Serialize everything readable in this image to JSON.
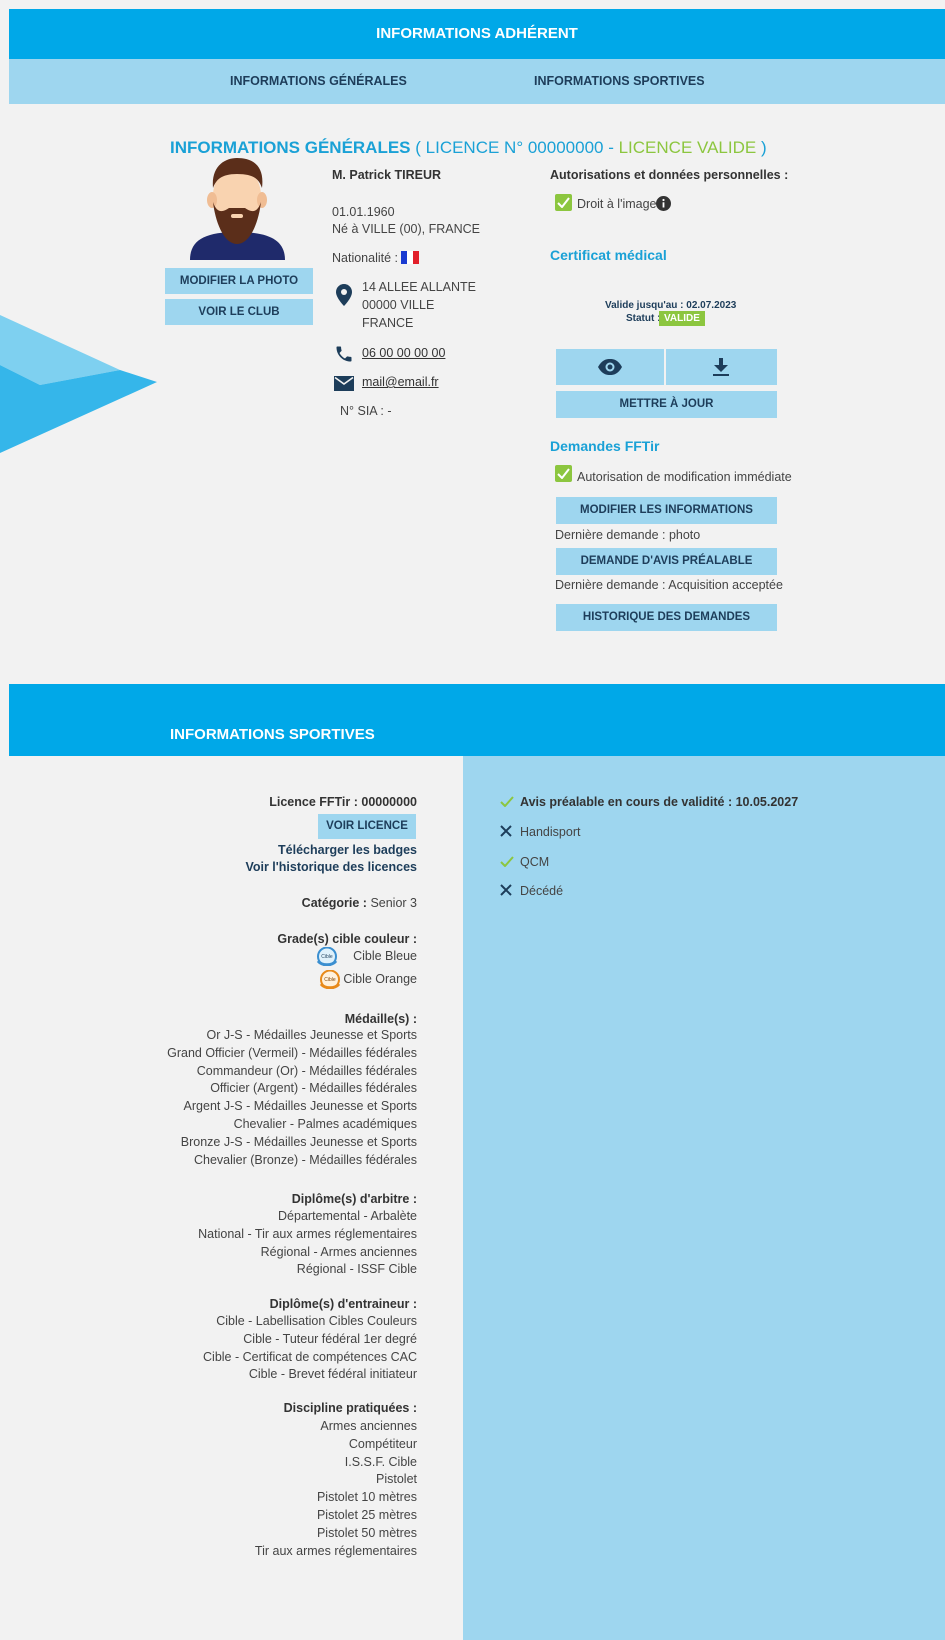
{
  "header": {
    "title": "INFORMATIONS ADHÉRENT"
  },
  "tabs": [
    {
      "label": "INFORMATIONS GÉNÉRALES"
    },
    {
      "label": "INFORMATIONS SPORTIVES"
    }
  ],
  "general": {
    "title": "INFORMATIONS GÉNÉRALES",
    "licence_prefix": " ( LICENCE N° 00000000 - ",
    "licence_status": "LICENCE VALIDE",
    "licence_suffix": " )",
    "modify_photo_label": "MODIFIER LA PHOTO",
    "see_club_label": "VOIR LE CLUB",
    "name": "M. Patrick TIREUR",
    "birth_date": "01.01.1960",
    "birth_place": "Né à  VILLE (00), FRANCE",
    "nationality_label": "Nationalité :",
    "address_line1": "14 ALLEE ALLANTE",
    "address_line2": "00000 VILLE",
    "address_line3": "FRANCE",
    "phone": "06 00 00 00 00",
    "email": "mail@email.fr",
    "sia": "N° SIA : -"
  },
  "authorizations": {
    "title": "Autorisations et données personnelles :",
    "image_right": "Droit à l'image"
  },
  "medical": {
    "title": "Certificat médical",
    "valid_until": "Valide jusqu'au : 02.07.2023",
    "status_label": "Statut :",
    "status_value": "VALIDE",
    "update_label": "METTRE À JOUR"
  },
  "requests": {
    "title": "Demandes FFTir",
    "immediate": "Autorisation de modification immédiate",
    "modify_label": "MODIFIER LES INFORMATIONS",
    "last_request_1": "Dernière demande : photo",
    "prior_opinion_label": "DEMANDE D'AVIS PRÉALABLE",
    "last_request_2": "Dernière demande : Acquisition acceptée",
    "history_label": "HISTORIQUE DES DEMANDES"
  },
  "sport": {
    "title": "INFORMATIONS SPORTIVES",
    "licence_label": "Licence FFTir :  00000000",
    "see_licence_label": "VOIR LICENCE",
    "download_badges": "Télécharger les badges",
    "licence_history": "Voir l'historique des licences",
    "category_label": "Catégorie :",
    "category_value": " Senior 3",
    "grades_title": "Grade(s) cible couleur :",
    "grades": [
      "Cible Bleue",
      "Cible Orange"
    ],
    "medals_title": "Médaille(s) :",
    "medals": [
      "Or J-S - Médailles Jeunesse et Sports",
      "Grand Officier (Vermeil) - Médailles fédérales",
      "Commandeur (Or) - Médailles fédérales",
      "Officier (Argent) - Médailles fédérales",
      "Argent J-S - Médailles Jeunesse et Sports",
      "Chevalier - Palmes académiques",
      "Bronze J-S - Médailles Jeunesse et Sports",
      "Chevalier (Bronze) - Médailles fédérales"
    ],
    "referee_title": "Diplôme(s) d'arbitre :",
    "referee": [
      "Départemental - Arbalète",
      "National - Tir aux armes réglementaires",
      "Régional - Armes anciennes",
      "Régional - ISSF Cible"
    ],
    "coach_title": "Diplôme(s) d'entraineur :",
    "coach": [
      "Cible - Labellisation Cibles Couleurs",
      "Cible - Tuteur fédéral 1er degré",
      "Cible - Certificat de compétences CAC",
      "Cible - Brevet fédéral initiateur"
    ],
    "disciplines_title": "Discipline pratiquées :",
    "disciplines": [
      "Armes anciennes",
      "Compétiteur",
      "I.S.S.F. Cible",
      "Pistolet",
      "Pistolet 10 mètres",
      "Pistolet 25 mètres",
      "Pistolet 50 mètres",
      "Tir aux armes réglementaires"
    ],
    "statuses": [
      {
        "label": "Avis préalable en cours de validité : 10.05.2027",
        "ok": true,
        "bold": true
      },
      {
        "label": "Handisport",
        "ok": false,
        "bold": false
      },
      {
        "label": "QCM",
        "ok": true,
        "bold": false
      },
      {
        "label": "Décédé",
        "ok": false,
        "bold": false
      }
    ]
  },
  "colors": {
    "primary": "#00a8e8",
    "light": "#9ed6ef",
    "navy": "#1d3d5a",
    "green": "#8cc63f"
  }
}
